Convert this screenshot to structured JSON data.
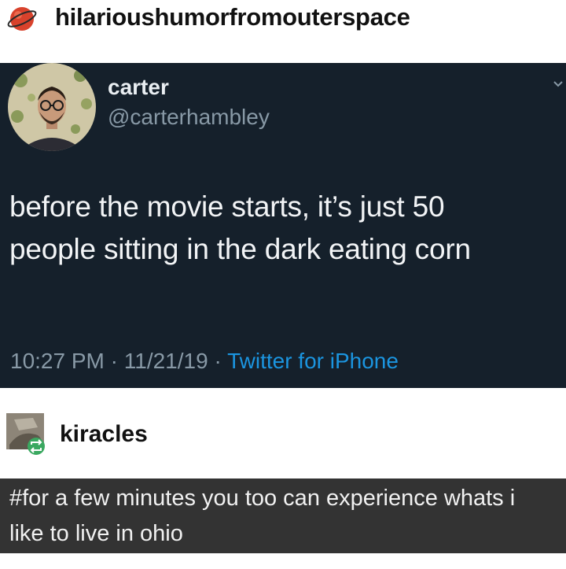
{
  "post": {
    "username": "hilarioushumorfromouterspace",
    "avatar_icon": "planet-icon"
  },
  "tweet": {
    "name": "carter",
    "handle": "@carterhambley",
    "text_line1": "before the movie starts, it’s just 50",
    "text_line2": "people sitting in the dark eating corn",
    "time": "10:27 PM",
    "date": "11/21/19",
    "separator": "·",
    "source": "Twitter for iPhone",
    "background": "#15202b",
    "link_color": "#1b95e0"
  },
  "reblog": {
    "username": "kiracles",
    "badge_icon": "reblog-icon",
    "comment_line1": "#for a few minutes you too can experience whats i",
    "comment_line2": "like to live in ohio"
  }
}
